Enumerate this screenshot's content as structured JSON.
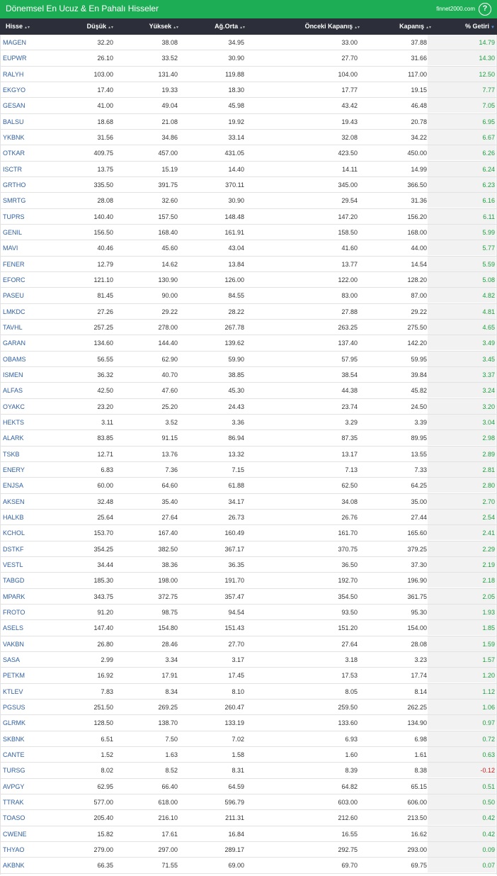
{
  "header": {
    "title": "Dönemsel En Ucuz & En Pahalı Hisseler",
    "site": "finnet2000.com",
    "help": "?"
  },
  "columns": [
    "Hisse",
    "Düşük",
    "Yüksek",
    "Ağ.Orta",
    "Önceki Kapanış",
    "Kapanış",
    "% Getiri"
  ],
  "sort_icons": {
    "inactive": "sort-both-icon",
    "active": "sort-desc-icon"
  },
  "colors": {
    "header_bg": "#1dae55",
    "table_header_bg": "#2c2f3a",
    "positive": "#1e9e3e",
    "negative": "#cc1d1d",
    "ticker": "#2f5f9e"
  },
  "rows": [
    [
      "MAGEN",
      "32.20",
      "38.08",
      "34.95",
      "33.00",
      "37.88",
      "14.79"
    ],
    [
      "EUPWR",
      "26.10",
      "33.52",
      "30.90",
      "27.70",
      "31.66",
      "14.30"
    ],
    [
      "RALYH",
      "103.00",
      "131.40",
      "119.88",
      "104.00",
      "117.00",
      "12.50"
    ],
    [
      "EKGYO",
      "17.40",
      "19.33",
      "18.30",
      "17.77",
      "19.15",
      "7.77"
    ],
    [
      "GESAN",
      "41.00",
      "49.04",
      "45.98",
      "43.42",
      "46.48",
      "7.05"
    ],
    [
      "BALSU",
      "18.68",
      "21.08",
      "19.92",
      "19.43",
      "20.78",
      "6.95"
    ],
    [
      "YKBNK",
      "31.56",
      "34.86",
      "33.14",
      "32.08",
      "34.22",
      "6.67"
    ],
    [
      "OTKAR",
      "409.75",
      "457.00",
      "431.05",
      "423.50",
      "450.00",
      "6.26"
    ],
    [
      "ISCTR",
      "13.75",
      "15.19",
      "14.40",
      "14.11",
      "14.99",
      "6.24"
    ],
    [
      "GRTHO",
      "335.50",
      "391.75",
      "370.11",
      "345.00",
      "366.50",
      "6.23"
    ],
    [
      "SMRTG",
      "28.08",
      "32.60",
      "30.90",
      "29.54",
      "31.36",
      "6.16"
    ],
    [
      "TUPRS",
      "140.40",
      "157.50",
      "148.48",
      "147.20",
      "156.20",
      "6.11"
    ],
    [
      "GENIL",
      "156.50",
      "168.40",
      "161.91",
      "158.50",
      "168.00",
      "5.99"
    ],
    [
      "MAVI",
      "40.46",
      "45.60",
      "43.04",
      "41.60",
      "44.00",
      "5.77"
    ],
    [
      "FENER",
      "12.79",
      "14.62",
      "13.84",
      "13.77",
      "14.54",
      "5.59"
    ],
    [
      "EFORC",
      "121.10",
      "130.90",
      "126.00",
      "122.00",
      "128.20",
      "5.08"
    ],
    [
      "PASEU",
      "81.45",
      "90.00",
      "84.55",
      "83.00",
      "87.00",
      "4.82"
    ],
    [
      "LMKDC",
      "27.26",
      "29.22",
      "28.22",
      "27.88",
      "29.22",
      "4.81"
    ],
    [
      "TAVHL",
      "257.25",
      "278.00",
      "267.78",
      "263.25",
      "275.50",
      "4.65"
    ],
    [
      "GARAN",
      "134.60",
      "144.40",
      "139.62",
      "137.40",
      "142.20",
      "3.49"
    ],
    [
      "OBAMS",
      "56.55",
      "62.90",
      "59.90",
      "57.95",
      "59.95",
      "3.45"
    ],
    [
      "ISMEN",
      "36.32",
      "40.70",
      "38.85",
      "38.54",
      "39.84",
      "3.37"
    ],
    [
      "ALFAS",
      "42.50",
      "47.60",
      "45.30",
      "44.38",
      "45.82",
      "3.24"
    ],
    [
      "OYAKC",
      "23.20",
      "25.20",
      "24.43",
      "23.74",
      "24.50",
      "3.20"
    ],
    [
      "HEKTS",
      "3.11",
      "3.52",
      "3.36",
      "3.29",
      "3.39",
      "3.04"
    ],
    [
      "ALARK",
      "83.85",
      "91.15",
      "86.94",
      "87.35",
      "89.95",
      "2.98"
    ],
    [
      "TSKB",
      "12.71",
      "13.76",
      "13.32",
      "13.17",
      "13.55",
      "2.89"
    ],
    [
      "ENERY",
      "6.83",
      "7.36",
      "7.15",
      "7.13",
      "7.33",
      "2.81"
    ],
    [
      "ENJSA",
      "60.00",
      "64.60",
      "61.88",
      "62.50",
      "64.25",
      "2.80"
    ],
    [
      "AKSEN",
      "32.48",
      "35.40",
      "34.17",
      "34.08",
      "35.00",
      "2.70"
    ],
    [
      "HALKB",
      "25.64",
      "27.64",
      "26.73",
      "26.76",
      "27.44",
      "2.54"
    ],
    [
      "KCHOL",
      "153.70",
      "167.40",
      "160.49",
      "161.70",
      "165.60",
      "2.41"
    ],
    [
      "DSTKF",
      "354.25",
      "382.50",
      "367.17",
      "370.75",
      "379.25",
      "2.29"
    ],
    [
      "VESTL",
      "34.44",
      "38.36",
      "36.35",
      "36.50",
      "37.30",
      "2.19"
    ],
    [
      "TABGD",
      "185.30",
      "198.00",
      "191.70",
      "192.70",
      "196.90",
      "2.18"
    ],
    [
      "MPARK",
      "343.75",
      "372.75",
      "357.47",
      "354.50",
      "361.75",
      "2.05"
    ],
    [
      "FROTO",
      "91.20",
      "98.75",
      "94.54",
      "93.50",
      "95.30",
      "1.93"
    ],
    [
      "ASELS",
      "147.40",
      "154.80",
      "151.43",
      "151.20",
      "154.00",
      "1.85"
    ],
    [
      "VAKBN",
      "26.80",
      "28.46",
      "27.70",
      "27.64",
      "28.08",
      "1.59"
    ],
    [
      "SASA",
      "2.99",
      "3.34",
      "3.17",
      "3.18",
      "3.23",
      "1.57"
    ],
    [
      "PETKM",
      "16.92",
      "17.91",
      "17.45",
      "17.53",
      "17.74",
      "1.20"
    ],
    [
      "KTLEV",
      "7.83",
      "8.34",
      "8.10",
      "8.05",
      "8.14",
      "1.12"
    ],
    [
      "PGSUS",
      "251.50",
      "269.25",
      "260.47",
      "259.50",
      "262.25",
      "1.06"
    ],
    [
      "GLRMK",
      "128.50",
      "138.70",
      "133.19",
      "133.60",
      "134.90",
      "0.97"
    ],
    [
      "SKBNK",
      "6.51",
      "7.50",
      "7.02",
      "6.93",
      "6.98",
      "0.72"
    ],
    [
      "CANTE",
      "1.52",
      "1.63",
      "1.58",
      "1.60",
      "1.61",
      "0.63"
    ],
    [
      "TURSG",
      "8.02",
      "8.52",
      "8.31",
      "8.39",
      "8.38",
      "-0.12"
    ],
    [
      "AVPGY",
      "62.95",
      "66.40",
      "64.59",
      "64.82",
      "65.15",
      "0.51"
    ],
    [
      "TTRAK",
      "577.00",
      "618.00",
      "596.79",
      "603.00",
      "606.00",
      "0.50"
    ],
    [
      "TOASO",
      "205.40",
      "216.10",
      "211.31",
      "212.60",
      "213.50",
      "0.42"
    ],
    [
      "CWENE",
      "15.82",
      "17.61",
      "16.84",
      "16.55",
      "16.62",
      "0.42"
    ],
    [
      "THYAO",
      "279.00",
      "297.00",
      "289.17",
      "292.75",
      "293.00",
      "0.09"
    ],
    [
      "AKBNK",
      "66.35",
      "71.55",
      "69.00",
      "69.70",
      "69.75",
      "0.07"
    ]
  ]
}
